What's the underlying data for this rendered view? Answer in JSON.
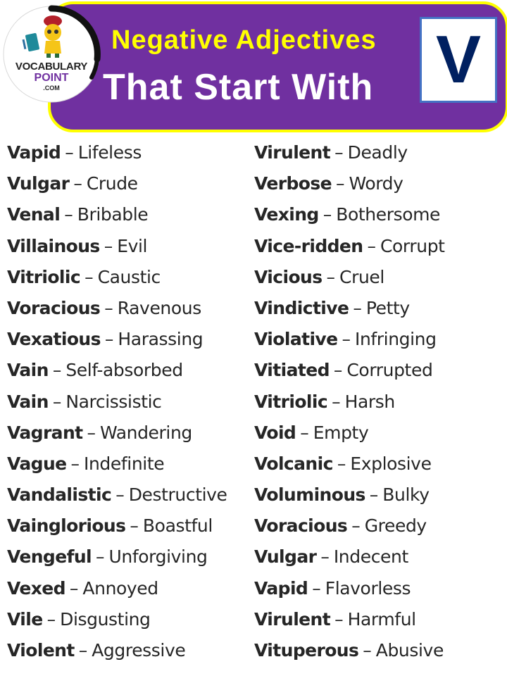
{
  "header": {
    "title_line1": "Negative Adjectives",
    "title_line2": "That Start With",
    "letter": "V",
    "colors": {
      "banner_bg": "#7030a0",
      "banner_border": "#ffff00",
      "title_line1": "#ffff00",
      "title_line2": "#ffffff",
      "letter": "#002060",
      "letter_box_border": "#4472c4"
    }
  },
  "logo": {
    "name": "VOCABULARY",
    "sub": "POINT",
    "domain": ".COM",
    "icon": "mascot-with-book-icon"
  },
  "separator": "–",
  "columns": [
    {
      "entries": [
        {
          "word": "Vapid",
          "meaning": "Lifeless"
        },
        {
          "word": "Vulgar",
          "meaning": "Crude"
        },
        {
          "word": "Venal",
          "meaning": "Bribable"
        },
        {
          "word": "Villainous",
          "meaning": "Evil"
        },
        {
          "word": "Vitriolic",
          "meaning": "Caustic"
        },
        {
          "word": "Voracious",
          "meaning": "Ravenous"
        },
        {
          "word": "Vexatious",
          "meaning": "Harassing"
        },
        {
          "word": "Vain",
          "meaning": "Self-absorbed"
        },
        {
          "word": "Vain",
          "meaning": "Narcissistic"
        },
        {
          "word": "Vagrant",
          "meaning": "Wandering"
        },
        {
          "word": "Vague",
          "meaning": "Indefinite"
        },
        {
          "word": "Vandalistic",
          "meaning": "Destructive"
        },
        {
          "word": "Vainglorious",
          "meaning": "Boastful"
        },
        {
          "word": "Vengeful",
          "meaning": "Unforgiving"
        },
        {
          "word": "Vexed",
          "meaning": "Annoyed"
        },
        {
          "word": "Vile",
          "meaning": "Disgusting"
        },
        {
          "word": "Violent",
          "meaning": "Aggressive"
        }
      ]
    },
    {
      "entries": [
        {
          "word": "Virulent",
          "meaning": "Deadly"
        },
        {
          "word": "Verbose",
          "meaning": "Wordy"
        },
        {
          "word": "Vexing",
          "meaning": "Bothersome"
        },
        {
          "word": "Vice-ridden",
          "meaning": "Corrupt"
        },
        {
          "word": "Vicious",
          "meaning": "Cruel"
        },
        {
          "word": "Vindictive",
          "meaning": "Petty"
        },
        {
          "word": "Violative",
          "meaning": "Infringing"
        },
        {
          "word": "Vitiated",
          "meaning": "Corrupted"
        },
        {
          "word": "Vitriolic",
          "meaning": "Harsh"
        },
        {
          "word": "Void",
          "meaning": "Empty"
        },
        {
          "word": "Volcanic",
          "meaning": "Explosive"
        },
        {
          "word": "Voluminous",
          "meaning": "Bulky"
        },
        {
          "word": "Voracious",
          "meaning": "Greedy"
        },
        {
          "word": "Vulgar",
          "meaning": "Indecent"
        },
        {
          "word": "Vapid",
          "meaning": "Flavorless"
        },
        {
          "word": "Virulent",
          "meaning": "Harmful"
        },
        {
          "word": "Vituperous",
          "meaning": "Abusive"
        }
      ]
    }
  ]
}
